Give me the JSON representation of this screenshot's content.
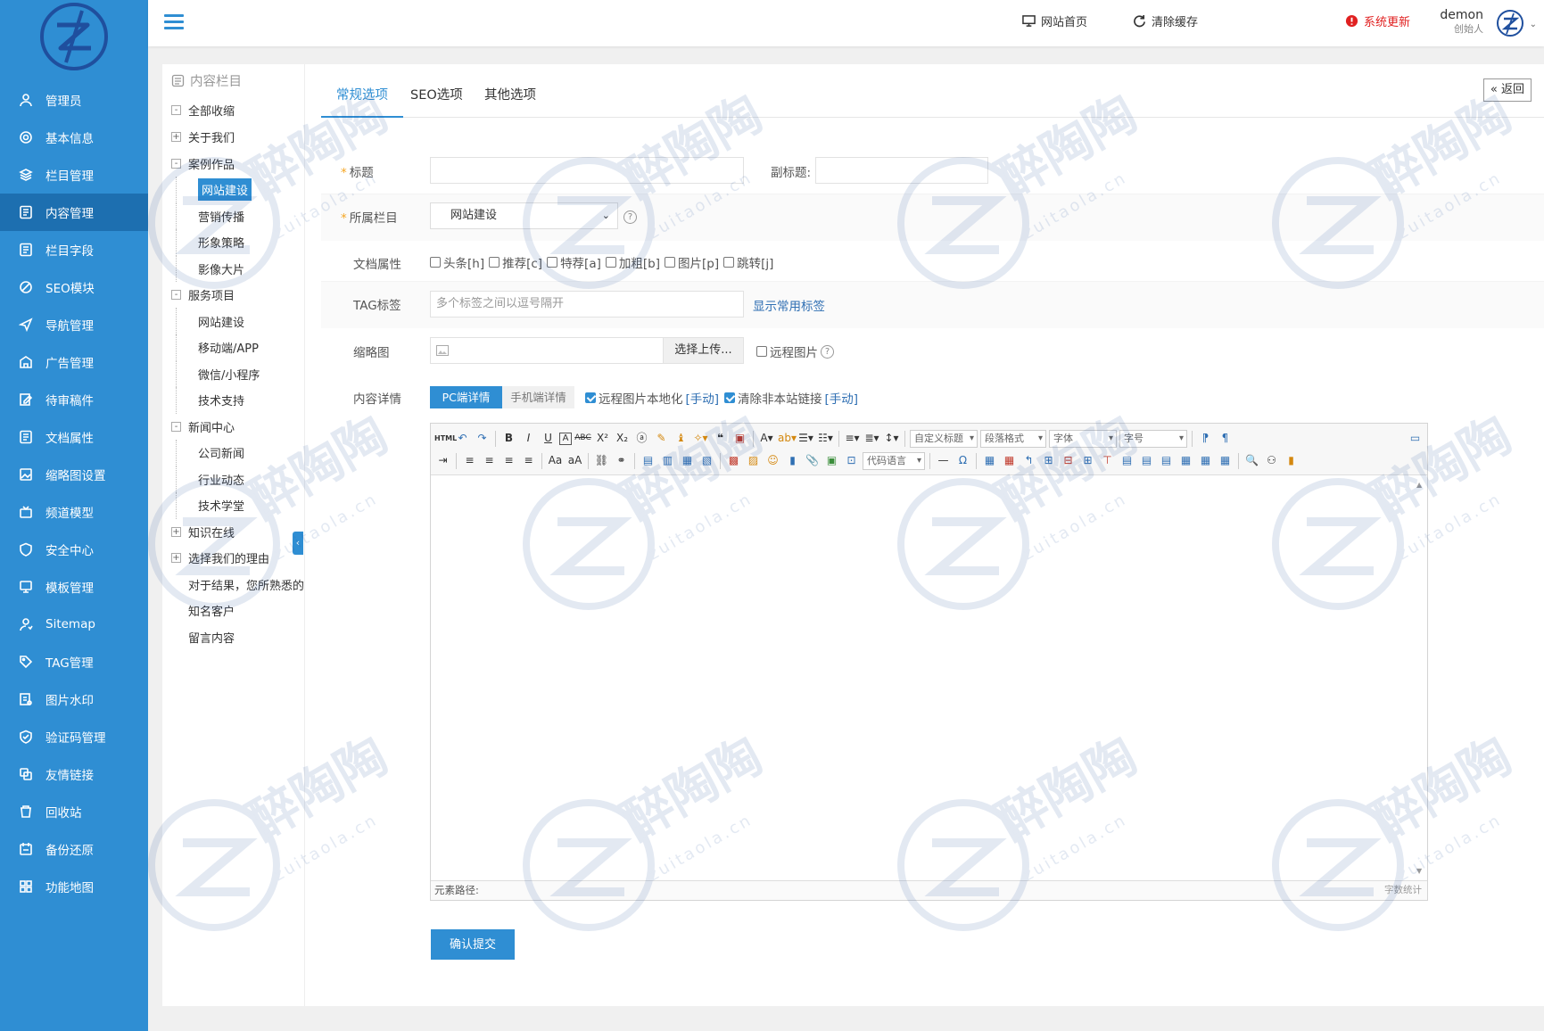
{
  "sidebar": {
    "items": [
      {
        "label": "管理员",
        "icon": "user-icon"
      },
      {
        "label": "基本信息",
        "icon": "gear-icon"
      },
      {
        "label": "栏目管理",
        "icon": "layers-icon"
      },
      {
        "label": "内容管理",
        "icon": "document-icon",
        "active": true
      },
      {
        "label": "栏目字段",
        "icon": "document-icon"
      },
      {
        "label": "SEO模块",
        "icon": "seo-icon"
      },
      {
        "label": "导航管理",
        "icon": "navigation-icon"
      },
      {
        "label": "广告管理",
        "icon": "ad-icon"
      },
      {
        "label": "待审稿件",
        "icon": "edit-icon"
      },
      {
        "label": "文档属性",
        "icon": "document-icon"
      },
      {
        "label": "缩略图设置",
        "icon": "image-icon"
      },
      {
        "label": "频道模型",
        "icon": "tv-icon"
      },
      {
        "label": "安全中心",
        "icon": "shield-icon"
      },
      {
        "label": "模板管理",
        "icon": "monitor-icon"
      },
      {
        "label": "Sitemap",
        "icon": "sitemap-icon"
      },
      {
        "label": "TAG管理",
        "icon": "tag-icon"
      },
      {
        "label": "图片水印",
        "icon": "watermark-icon"
      },
      {
        "label": "验证码管理",
        "icon": "check-shield-icon"
      },
      {
        "label": "友情链接",
        "icon": "link-icon"
      },
      {
        "label": "回收站",
        "icon": "trash-icon"
      },
      {
        "label": "备份还原",
        "icon": "backup-icon"
      },
      {
        "label": "功能地图",
        "icon": "grid-icon"
      }
    ]
  },
  "topbar": {
    "home_label": "网站首页",
    "clear_cache_label": "清除缓存",
    "update_label": "系统更新",
    "user_name": "demon",
    "user_role": "创始人"
  },
  "tree": {
    "title": "内容栏目",
    "items": [
      {
        "label": "全部收缩",
        "level": 0,
        "toggle": "-"
      },
      {
        "label": "关于我们",
        "level": 0,
        "toggle": "+"
      },
      {
        "label": "案例作品",
        "level": 0,
        "toggle": "-"
      },
      {
        "label": "网站建设",
        "level": 1,
        "selected": true
      },
      {
        "label": "营销传播",
        "level": 1
      },
      {
        "label": "形象策略",
        "level": 1
      },
      {
        "label": "影像大片",
        "level": 1
      },
      {
        "label": "服务项目",
        "level": 0,
        "toggle": "-"
      },
      {
        "label": "网站建设",
        "level": 1
      },
      {
        "label": "移动端/APP",
        "level": 1
      },
      {
        "label": "微信/小程序",
        "level": 1
      },
      {
        "label": "技术支持",
        "level": 1
      },
      {
        "label": "新闻中心",
        "level": 0,
        "toggle": "-"
      },
      {
        "label": "公司新闻",
        "level": 1
      },
      {
        "label": "行业动态",
        "level": 1
      },
      {
        "label": "技术学堂",
        "level": 1
      },
      {
        "label": "知识在线",
        "level": 0,
        "toggle": "+"
      },
      {
        "label": "选择我们的理由",
        "level": 0,
        "toggle": "+"
      },
      {
        "label": "对于结果，您所熟悉的",
        "level": 0
      },
      {
        "label": "知名客户",
        "level": 0
      },
      {
        "label": "留言内容",
        "level": 0
      }
    ]
  },
  "tabs": [
    "常规选项",
    "SEO选项",
    "其他选项"
  ],
  "back_label": "« 返回",
  "form": {
    "title_label": "标题",
    "subtitle_label": "副标题:",
    "category_label": "所属栏目",
    "category_value": "网站建设",
    "attr_label": "文档属性",
    "attrs": [
      "头条[h]",
      "推荐[c]",
      "特荐[a]",
      "加粗[b]",
      "图片[p]",
      "跳转[j]"
    ],
    "tag_label": "TAG标签",
    "tag_placeholder": "多个标签之间以逗号隔开",
    "tag_link": "显示常用标签",
    "thumb_label": "缩略图",
    "upload_label": "选择上传...",
    "remote_image_label": "远程图片",
    "content_label": "内容详情",
    "pc_tab": "PC端详情",
    "mobile_tab": "手机端详情",
    "localize_label": "远程图片本地化",
    "localize_manual": "[手动]",
    "clear_links_label": "清除非本站链接",
    "clear_links_manual": "[手动]"
  },
  "editor": {
    "custom_title": "自定义标题",
    "paragraph": "段落格式",
    "font": "字体",
    "size": "字号",
    "code_lang": "代码语言",
    "path_label": "元素路径:",
    "word_count": "字数统计"
  },
  "submit_label": "确认提交",
  "watermark": {
    "brand": "醉陶陶",
    "domain": "zuitaola.cn"
  },
  "colors": {
    "primary": "#2f8ed3",
    "sidebar_active": "#1d6fb0",
    "required": "#f5a623",
    "update": "#e02020"
  }
}
